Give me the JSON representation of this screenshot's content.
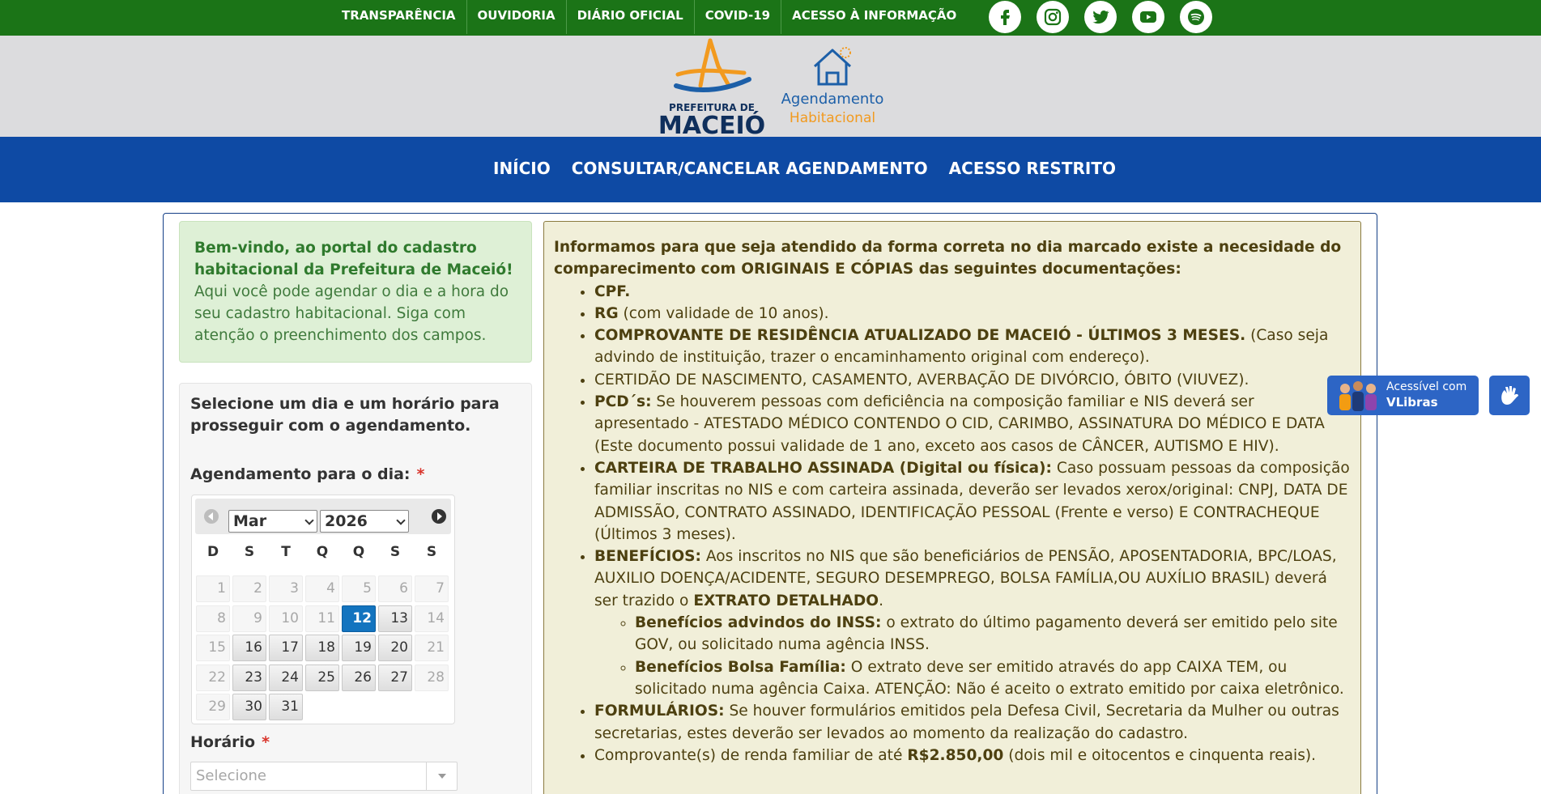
{
  "topnav": {
    "links": [
      "TRANSPARÊNCIA",
      "OUVIDORIA",
      "DIÁRIO OFICIAL",
      "COVID-19",
      "ACESSO À INFORMAÇÃO"
    ]
  },
  "socials": [
    "facebook-icon",
    "instagram-icon",
    "twitter-icon",
    "youtube-icon",
    "spotify-icon"
  ],
  "brand": {
    "prefeitura_de": "PREFEITURA DE",
    "maceio": "MACEIÓ",
    "agend_line1": "Agendamento",
    "agend_line2": "Habitacional",
    "colors": {
      "green": "#1b7417",
      "blue": "#0e4aa4",
      "orange": "#f29a1f"
    }
  },
  "mainnav": {
    "items": [
      "INÍCIO",
      "CONSULTAR/CANCELAR AGENDAMENTO",
      "ACESSO RESTRITO"
    ]
  },
  "welcome": {
    "bold": "Bem-vindo, ao portal do cadastro habitacional da Prefeitura de Maceió!",
    "text": "Aqui você pode agendar o dia e a hora do seu cadastro habitacional. Siga com atenção o preenchimento dos campos."
  },
  "schedule": {
    "title": "Selecione um dia e um horário para prosseguir com o agendamento.",
    "date_label": "Agendamento para o dia:",
    "required_mark": "*",
    "time_label": "Horário",
    "time_placeholder": "Selecione"
  },
  "calendar": {
    "month": "Mar",
    "year": "2026",
    "weekdays": [
      "D",
      "S",
      "T",
      "Q",
      "Q",
      "S",
      "S"
    ],
    "selected_day": 12,
    "weeks": [
      [
        {
          "d": "1",
          "s": "past"
        },
        {
          "d": "2",
          "s": "past"
        },
        {
          "d": "3",
          "s": "past"
        },
        {
          "d": "4",
          "s": "past"
        },
        {
          "d": "5",
          "s": "past"
        },
        {
          "d": "6",
          "s": "past"
        },
        {
          "d": "7",
          "s": "past"
        }
      ],
      [
        {
          "d": "8",
          "s": "past"
        },
        {
          "d": "9",
          "s": "past"
        },
        {
          "d": "10",
          "s": "past"
        },
        {
          "d": "11",
          "s": "past"
        },
        {
          "d": "12",
          "s": "sel"
        },
        {
          "d": "13",
          "s": "avail"
        },
        {
          "d": "14",
          "s": "past"
        }
      ],
      [
        {
          "d": "15",
          "s": "past"
        },
        {
          "d": "16",
          "s": "avail"
        },
        {
          "d": "17",
          "s": "avail"
        },
        {
          "d": "18",
          "s": "avail"
        },
        {
          "d": "19",
          "s": "avail"
        },
        {
          "d": "20",
          "s": "avail"
        },
        {
          "d": "21",
          "s": "past"
        }
      ],
      [
        {
          "d": "22",
          "s": "past"
        },
        {
          "d": "23",
          "s": "avail"
        },
        {
          "d": "24",
          "s": "avail"
        },
        {
          "d": "25",
          "s": "avail"
        },
        {
          "d": "26",
          "s": "avail"
        },
        {
          "d": "27",
          "s": "avail"
        },
        {
          "d": "28",
          "s": "past"
        }
      ],
      [
        {
          "d": "29",
          "s": "past"
        },
        {
          "d": "30",
          "s": "avail"
        },
        {
          "d": "31",
          "s": "avail"
        }
      ]
    ]
  },
  "info": {
    "intro": "Informamos para que seja atendido da forma correta no dia marcado existe a necesidade do comparecimento com ORIGINAIS E CÓPIAS das seguintes documentações:",
    "items": [
      {
        "b": "CPF.",
        "t": ""
      },
      {
        "b": "RG",
        "t": " (com validade de 10 anos)."
      },
      {
        "b": "COMPROVANTE DE RESIDÊNCIA ATUALIZADO DE MACEIÓ - ÚLTIMOS 3 MESES.",
        "t": " (Caso seja advindo de instituição, trazer o encaminhamento original com endereço)."
      },
      {
        "b": "",
        "t": "CERTIDÃO DE NASCIMENTO, CASAMENTO, AVERBAÇÃO DE DIVÓRCIO, ÓBITO (VIUVEZ)."
      },
      {
        "b": "PCD´s:",
        "t": " Se houverem pessoas com deficiência na composição familiar e NIS deverá ser apresentado - ATESTADO MÉDICO CONTENDO O CID, CARIMBO, ASSINATURA DO MÉDICO E DATA (Este documento possui validade de 1 ano, exceto aos casos de CÂNCER, AUTISMO E HIV)."
      },
      {
        "b": "CARTEIRA DE TRABALHO ASSINADA (Digital ou física):",
        "t": " Caso possuam pessoas da composição familiar inscritas no NIS e com carteira assinada, deverão ser levados xerox/original: CNPJ, DATA DE ADMISSÃO, CONTRATO ASSINADO, IDENTIFICAÇÃO PESSOAL (Frente e verso) E CONTRACHEQUE (Últimos 3 meses)."
      },
      {
        "b": "BENEFÍCIOS:",
        "t": " Aos inscritos no NIS que são beneficiários de PENSÃO, APOSENTADORIA, BPC/LOAS, AUXILIO DOENÇA/ACIDENTE, SEGURO DESEMPREGO, BOLSA FAMÍLIA,OU AUXÍLIO BRASIL) deverá ser trazido o ",
        "b2": "EXTRATO DETALHADO",
        "t2": ".",
        "sub": [
          {
            "b": "Benefícios advindos do INSS:",
            "t": " o extrato do último pagamento deverá ser emitido pelo site GOV, ou solicitado numa agência INSS."
          },
          {
            "b": "Benefícios Bolsa Família:",
            "t": " O extrato deve ser emitido através do app CAIXA TEM, ou solicitado numa agência Caixa. ATENÇÃO: Não é aceito o extrato emitido por caixa eletrônico."
          }
        ]
      },
      {
        "b": "FORMULÁRIOS:",
        "t": " Se houver formulários emitidos pela Defesa Civil, Secretaria da Mulher ou outras secretarias, estes deverão ser levados ao momento da realização do cadastro."
      },
      {
        "b": "",
        "t": "Comprovante(s) de renda familiar de até ",
        "b2": "R$2.850,00",
        "t2": " (dois mil e oitocentos e cinquenta reais)."
      }
    ]
  },
  "vlibras": {
    "line1": "Acessível com",
    "line2": "VLibras"
  }
}
